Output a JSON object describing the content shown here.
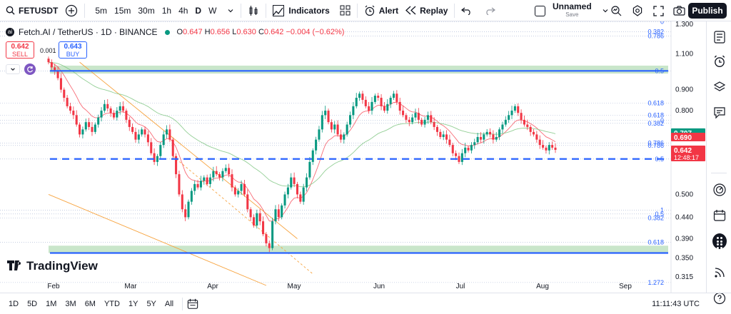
{
  "toolbar": {
    "symbol": "FETUSDT",
    "timeframes": [
      "5m",
      "15m",
      "30m",
      "1h",
      "4h",
      "D",
      "W"
    ],
    "active_timeframe": "D",
    "indicators_label": "Indicators",
    "alert_label": "Alert",
    "replay_label": "Replay",
    "layout_name": "Unnamed",
    "layout_status": "Save",
    "publish_label": "Publish"
  },
  "legend": {
    "title": "Fetch.AI / TetherUS · 1D · BINANCE",
    "open_label": "O",
    "open": "0.647",
    "high_label": "H",
    "high": "0.656",
    "low_label": "L",
    "low": "0.630",
    "close_label": "C",
    "close": "0.642",
    "change": "−0.004 (−0.62%)",
    "spread": "0.001"
  },
  "trade": {
    "sell_price": "0.642",
    "sell_label": "SELL",
    "buy_price": "0.643",
    "buy_label": "BUY"
  },
  "price_scale": {
    "ticks": [
      {
        "v": 1.3,
        "label": "1.300"
      },
      {
        "v": 1.1,
        "label": "1.100"
      },
      {
        "v": 0.9,
        "label": "0.900"
      },
      {
        "v": 0.8,
        "label": "0.800"
      },
      {
        "v": 0.5,
        "label": "0.500"
      },
      {
        "v": 0.44,
        "label": "0.440"
      },
      {
        "v": 0.39,
        "label": "0.390"
      },
      {
        "v": 0.35,
        "label": "0.350"
      },
      {
        "v": 0.315,
        "label": "0.315"
      }
    ],
    "badges": [
      {
        "v": 0.707,
        "label": "0.707",
        "color": "#089981"
      },
      {
        "v": 0.69,
        "label": "0.690",
        "color": "#f23645"
      },
      {
        "v": 0.642,
        "label": "0.642",
        "color": "#f23645",
        "sub": "12:48:17"
      }
    ]
  },
  "fib_labels": [
    {
      "v": 1.318,
      "label": "0"
    },
    {
      "v": 1.245,
      "label": "0.382"
    },
    {
      "v": 1.215,
      "label": "0.786"
    },
    {
      "v": 1.0,
      "label": "0.5"
    },
    {
      "v": 0.835,
      "label": "0.618"
    },
    {
      "v": 0.78,
      "label": "0.618"
    },
    {
      "v": 0.745,
      "label": "0.382"
    },
    {
      "v": 0.757,
      "label": "0"
    },
    {
      "v": 0.667,
      "label": "0.786"
    },
    {
      "v": 0.658,
      "label": "0.786"
    },
    {
      "v": 0.61,
      "label": "0.5"
    },
    {
      "v": 0.458,
      "label": "1"
    },
    {
      "v": 0.448,
      "label": "0.5"
    },
    {
      "v": 0.438,
      "label": "0.382"
    },
    {
      "v": 0.382,
      "label": "0.618"
    },
    {
      "v": 0.305,
      "label": "1.272"
    }
  ],
  "time_axis": [
    "Feb",
    "Mar",
    "Apr",
    "May",
    "Jun",
    "Jul",
    "Aug",
    "Sep"
  ],
  "bottombar": {
    "ranges": [
      "1D",
      "5D",
      "1M",
      "3M",
      "6M",
      "YTD",
      "1Y",
      "5Y",
      "All"
    ],
    "clock": "11:11:43 UTC"
  },
  "colors": {
    "up": "#089981",
    "down": "#f23645",
    "zone": "#a5d6a7",
    "level": "#2962ff",
    "fib": "#7d8fc0",
    "channel": "#f7a440",
    "ema_fast": "#f7525f",
    "ema_slow": "#81c784"
  },
  "chart_data": {
    "type": "candlestick",
    "symbol": "FETUSDT",
    "interval": "1D",
    "scale": "log",
    "ylim": [
      0.3,
      1.32
    ],
    "x_labels": [
      "Feb",
      "Mar",
      "Apr",
      "May",
      "Jun",
      "Jul",
      "Aug",
      "Sep"
    ],
    "last_price": 0.642,
    "zones": [
      {
        "from": 0.985,
        "to": 1.03
      },
      {
        "from": 0.36,
        "to": 0.375
      }
    ],
    "levels": [
      {
        "v": 1.0,
        "style": "solid"
      },
      {
        "v": 0.61,
        "style": "dashed"
      },
      {
        "v": 0.36,
        "style": "solid"
      }
    ],
    "closes": [
      1.05,
      1.02,
      1.0,
      0.96,
      0.9,
      0.86,
      0.82,
      0.8,
      0.78,
      0.74,
      0.7,
      0.72,
      0.75,
      0.73,
      0.71,
      0.74,
      0.77,
      0.8,
      0.83,
      0.81,
      0.79,
      0.77,
      0.8,
      0.82,
      0.8,
      0.76,
      0.73,
      0.71,
      0.68,
      0.7,
      0.72,
      0.7,
      0.67,
      0.63,
      0.6,
      0.62,
      0.66,
      0.7,
      0.72,
      0.68,
      0.62,
      0.56,
      0.5,
      0.46,
      0.44,
      0.48,
      0.51,
      0.53,
      0.52,
      0.54,
      0.55,
      0.53,
      0.55,
      0.57,
      0.56,
      0.55,
      0.57,
      0.58,
      0.56,
      0.52,
      0.5,
      0.51,
      0.53,
      0.5,
      0.46,
      0.44,
      0.42,
      0.45,
      0.43,
      0.4,
      0.38,
      0.37,
      0.43,
      0.46,
      0.44,
      0.47,
      0.5,
      0.52,
      0.55,
      0.53,
      0.5,
      0.48,
      0.52,
      0.55,
      0.6,
      0.64,
      0.68,
      0.72,
      0.78,
      0.8,
      0.75,
      0.72,
      0.74,
      0.7,
      0.68,
      0.7,
      0.74,
      0.78,
      0.82,
      0.86,
      0.88,
      0.85,
      0.82,
      0.8,
      0.84,
      0.87,
      0.86,
      0.82,
      0.8,
      0.83,
      0.86,
      0.88,
      0.84,
      0.8,
      0.78,
      0.76,
      0.75,
      0.77,
      0.79,
      0.76,
      0.74,
      0.76,
      0.78,
      0.75,
      0.73,
      0.71,
      0.69,
      0.7,
      0.68,
      0.66,
      0.63,
      0.62,
      0.6,
      0.63,
      0.65,
      0.64,
      0.66,
      0.67,
      0.69,
      0.68,
      0.7,
      0.71,
      0.7,
      0.68,
      0.69,
      0.72,
      0.74,
      0.76,
      0.78,
      0.8,
      0.82,
      0.79,
      0.76,
      0.74,
      0.73,
      0.71,
      0.7,
      0.68,
      0.66,
      0.65,
      0.64,
      0.66,
      0.65,
      0.642
    ]
  }
}
